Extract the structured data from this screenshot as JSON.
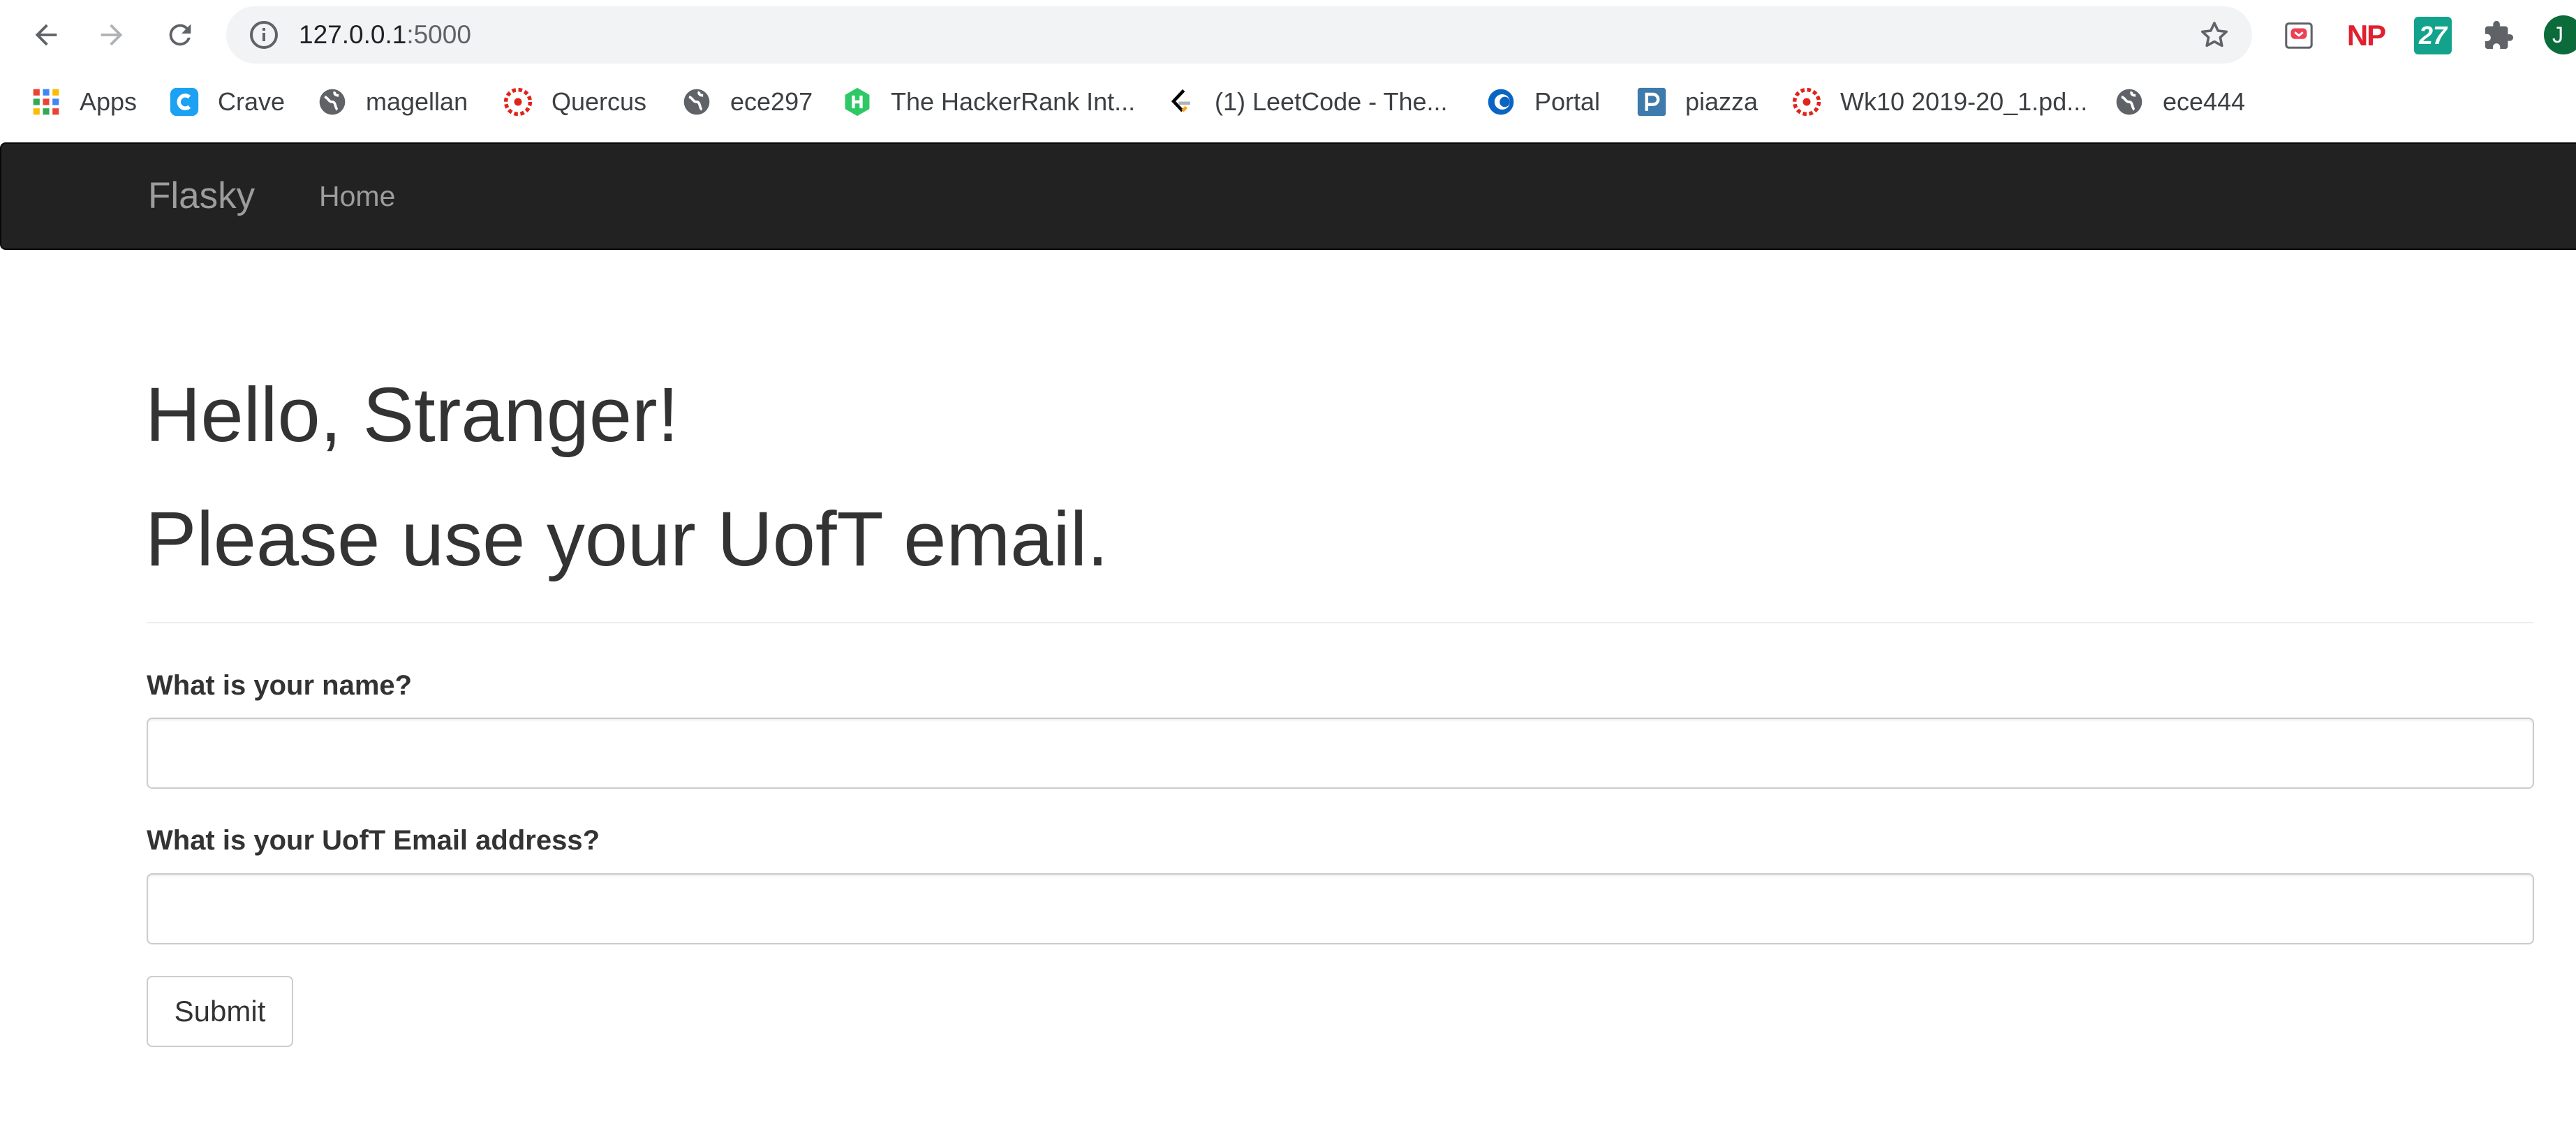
{
  "browser": {
    "url_host": "127.0.0.1",
    "url_port": ":5000",
    "avatar_letter": "J",
    "extensions": {
      "np_label": "NP",
      "badge_27_label": "27"
    }
  },
  "bookmarks": [
    {
      "label": "Apps",
      "icon": "apps-grid-icon"
    },
    {
      "label": "Crave",
      "icon": "crave-icon"
    },
    {
      "label": "magellan",
      "icon": "globe-icon"
    },
    {
      "label": "Quercus",
      "icon": "quercus-icon"
    },
    {
      "label": "ece297",
      "icon": "globe-icon"
    },
    {
      "label": "The HackerRank Int...",
      "icon": "hackerrank-icon"
    },
    {
      "label": "(1) LeetCode - The...",
      "icon": "leetcode-icon"
    },
    {
      "label": "Portal",
      "icon": "portal-icon"
    },
    {
      "label": "piazza",
      "icon": "piazza-icon"
    },
    {
      "label": "Wk10 2019-20_1.pd...",
      "icon": "quercus-icon"
    },
    {
      "label": "ece444",
      "icon": "globe-icon"
    }
  ],
  "navbar": {
    "brand": "Flasky",
    "home": "Home"
  },
  "page": {
    "greeting": "Hello, Stranger!",
    "instruction": "Please use your UofT email."
  },
  "form": {
    "name_label": "What is your name?",
    "name_value": "",
    "email_label": "What is your UofT Email address?",
    "email_value": "",
    "submit_label": "Submit"
  },
  "colors": {
    "navbar_bg": "#222222",
    "navbar_text": "#9d9d9d",
    "heading_text": "#333333"
  }
}
